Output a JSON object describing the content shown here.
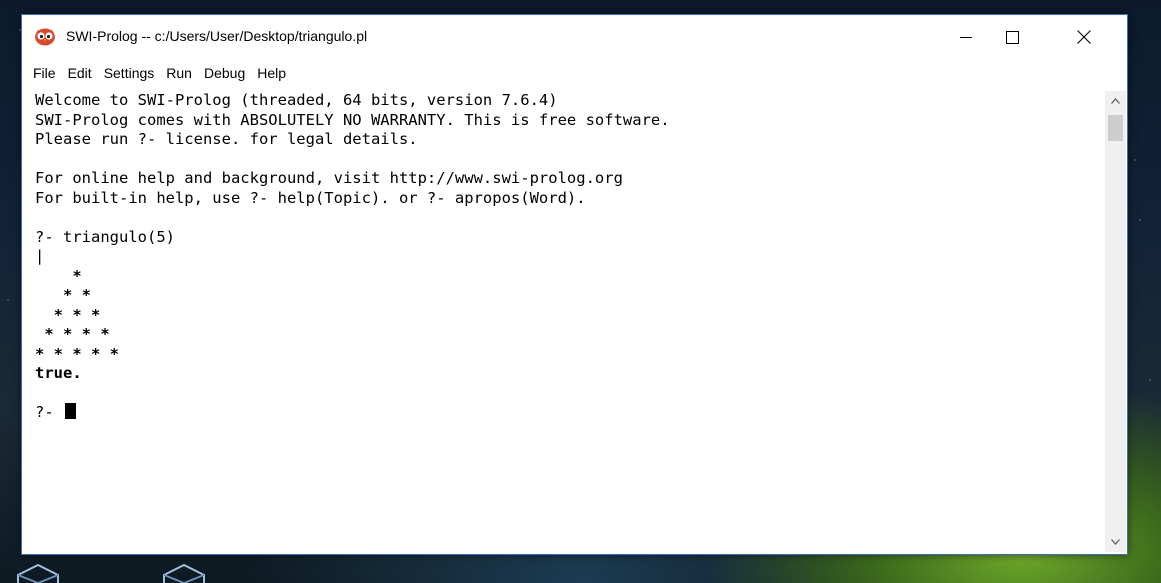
{
  "window": {
    "title": "SWI-Prolog -- c:/Users/User/Desktop/triangulo.pl",
    "icon": "owl-icon",
    "controls": [
      "minimize-icon",
      "maximize-icon",
      "close-icon"
    ]
  },
  "menu": [
    "File",
    "Edit",
    "Settings",
    "Run",
    "Debug",
    "Help"
  ],
  "console": {
    "banner": [
      "Welcome to SWI-Prolog (threaded, 64 bits, version 7.6.4)",
      "SWI-Prolog comes with ABSOLUTELY NO WARRANTY. This is free software.",
      "Please run ?- license. for legal details."
    ],
    "help": [
      "For online help and background, visit http://www.swi-prolog.org",
      "For built-in help, use ?- help(Topic). or ?- apropos(Word)."
    ],
    "query": "?- triangulo(5)",
    "output_marker": "|",
    "triangle": [
      "    *",
      "   * *",
      "  * * *",
      " * * * *",
      "* * * * *"
    ],
    "result": "true.",
    "prompt": "?- "
  },
  "colors": {
    "accent_border": "#3a6fb0"
  }
}
